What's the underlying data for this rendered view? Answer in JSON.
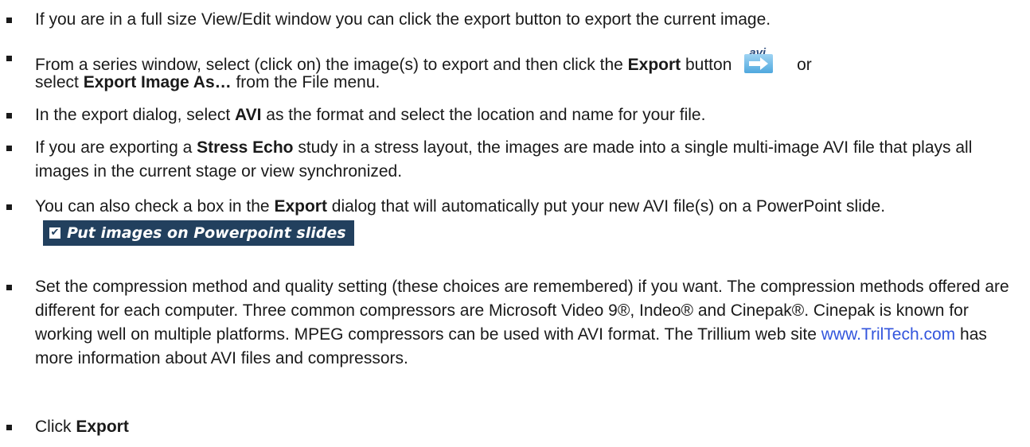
{
  "items": [
    {
      "text": "If you are in a full size View/Edit window you can click the export button to export the current image."
    },
    {
      "pre": "From a series window, select (click on) the image(s) to export and then click the ",
      "bold1": "Export",
      "mid": " button",
      "after_icon": "or",
      "pre2": "select ",
      "bold2": "Export Image As…",
      "post": " from the File menu.",
      "icon_label": "avi"
    },
    {
      "pre": "In the export dialog, select ",
      "bold": "AVI",
      "post": " as the format and select the location and name for your file."
    },
    {
      "pre": "If you are exporting a ",
      "bold": "Stress Echo",
      "post": " study in a stress layout, the images are made into a single multi-image AVI file that plays all images in the current stage or view synchronized."
    },
    {
      "pre": "You can also check a box in the ",
      "bold": "Export",
      "post": " dialog that will automatically put your new AVI file(s) on a PowerPoint slide.",
      "checkbox_label": "Put  images on Powerpoint slides"
    },
    {
      "pre": "Set the compression method and quality setting (these choices are remembered) if you want. The compression methods offered are different for each computer. Three common compressors are Microsoft Video 9®, Indeo® and Cinepak®. Cinepak is known for working well on multiple platforms. MPEG compressors can be used with AVI format. The Trillium web site ",
      "link": "www.TrilTech.com",
      "post": " has more information about AVI files and compressors."
    },
    {
      "pre": "Click ",
      "bold": "Export"
    }
  ],
  "colors": {
    "link": "#3355dd",
    "checkbox_bg": "#22405e"
  }
}
